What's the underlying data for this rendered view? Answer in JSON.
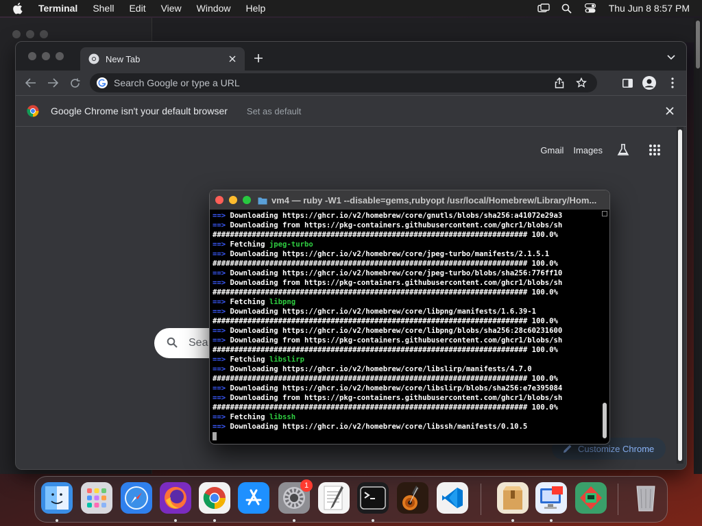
{
  "menubar": {
    "app_name": "Terminal",
    "items": [
      "Shell",
      "Edit",
      "View",
      "Window",
      "Help"
    ],
    "clock": "Thu Jun 8  8:57 PM"
  },
  "chrome": {
    "tab_title": "New Tab",
    "omnibox_placeholder": "Search Google or type a URL",
    "infobar_message": "Google Chrome isn't your default browser",
    "infobar_action": "Set as default",
    "ntp": {
      "gmail": "Gmail",
      "images": "Images",
      "search_placeholder": "Sea",
      "customize": "Customize Chrome"
    }
  },
  "terminal": {
    "title": "vm4 — ruby -W1 --disable=gems,rubyopt /usr/local/Homebrew/Library/Hom...",
    "lines": [
      {
        "arrow": "==> ",
        "text": "Downloading https://ghcr.io/v2/homebrew/core/gnutls/blobs/sha256:a41072e29a3",
        "pkg": ""
      },
      {
        "arrow": "==> ",
        "text": "Downloading from https://pkg-containers.githubusercontent.com/ghcr1/blobs/sh",
        "pkg": ""
      },
      {
        "arrow": "",
        "text": "######################################################################## 100.0%",
        "pkg": ""
      },
      {
        "arrow": "==> ",
        "text": "Fetching ",
        "pkg": "jpeg-turbo"
      },
      {
        "arrow": "==> ",
        "text": "Downloading https://ghcr.io/v2/homebrew/core/jpeg-turbo/manifests/2.1.5.1",
        "pkg": ""
      },
      {
        "arrow": "",
        "text": "######################################################################## 100.0%",
        "pkg": ""
      },
      {
        "arrow": "==> ",
        "text": "Downloading https://ghcr.io/v2/homebrew/core/jpeg-turbo/blobs/sha256:776ff10",
        "pkg": ""
      },
      {
        "arrow": "==> ",
        "text": "Downloading from https://pkg-containers.githubusercontent.com/ghcr1/blobs/sh",
        "pkg": ""
      },
      {
        "arrow": "",
        "text": "######################################################################## 100.0%",
        "pkg": ""
      },
      {
        "arrow": "==> ",
        "text": "Fetching ",
        "pkg": "libpng"
      },
      {
        "arrow": "==> ",
        "text": "Downloading https://ghcr.io/v2/homebrew/core/libpng/manifests/1.6.39-1",
        "pkg": ""
      },
      {
        "arrow": "",
        "text": "######################################################################## 100.0%",
        "pkg": ""
      },
      {
        "arrow": "==> ",
        "text": "Downloading https://ghcr.io/v2/homebrew/core/libpng/blobs/sha256:28c60231600",
        "pkg": ""
      },
      {
        "arrow": "==> ",
        "text": "Downloading from https://pkg-containers.githubusercontent.com/ghcr1/blobs/sh",
        "pkg": ""
      },
      {
        "arrow": "",
        "text": "######################################################################## 100.0%",
        "pkg": ""
      },
      {
        "arrow": "==> ",
        "text": "Fetching ",
        "pkg": "libslirp"
      },
      {
        "arrow": "==> ",
        "text": "Downloading https://ghcr.io/v2/homebrew/core/libslirp/manifests/4.7.0",
        "pkg": ""
      },
      {
        "arrow": "",
        "text": "######################################################################## 100.0%",
        "pkg": ""
      },
      {
        "arrow": "==> ",
        "text": "Downloading https://ghcr.io/v2/homebrew/core/libslirp/blobs/sha256:e7e395084",
        "pkg": ""
      },
      {
        "arrow": "==> ",
        "text": "Downloading from https://pkg-containers.githubusercontent.com/ghcr1/blobs/sh",
        "pkg": ""
      },
      {
        "arrow": "",
        "text": "######################################################################## 100.0%",
        "pkg": ""
      },
      {
        "arrow": "==> ",
        "text": "Fetching ",
        "pkg": "libssh"
      },
      {
        "arrow": "==> ",
        "text": "Downloading https://ghcr.io/v2/homebrew/core/libssh/manifests/0.10.5",
        "pkg": ""
      }
    ]
  },
  "dock": {
    "items": [
      {
        "name": "finder-icon",
        "bg": "#3a8ee6"
      },
      {
        "name": "launchpad-icon",
        "bg": "#d9d9de"
      },
      {
        "name": "safari-icon",
        "bg": "#2f80ed"
      },
      {
        "name": "firefox-icon",
        "bg": "#7b2cbf"
      },
      {
        "name": "chrome-icon",
        "bg": "#f2f2f2"
      },
      {
        "name": "app-store-icon",
        "bg": "#1e90ff"
      },
      {
        "name": "system-settings-icon",
        "bg": "#8e8e93"
      },
      {
        "name": "textedit-icon",
        "bg": "#f5f5f5"
      },
      {
        "name": "terminal-icon",
        "bg": "#1c1c1e"
      },
      {
        "name": "garageband-icon",
        "bg": "#2b1a10"
      },
      {
        "name": "vscode-icon",
        "bg": "#f2f2f2"
      },
      {
        "name": "archive-utility-icon",
        "bg": "#f0e6d2"
      },
      {
        "name": "screen-sharing-icon",
        "bg": "#e8f0ff"
      },
      {
        "name": "utm-icon",
        "bg": "#3aa06a"
      },
      {
        "name": "trash-icon",
        "bg": "transparent"
      }
    ],
    "settings_badge": "1"
  }
}
